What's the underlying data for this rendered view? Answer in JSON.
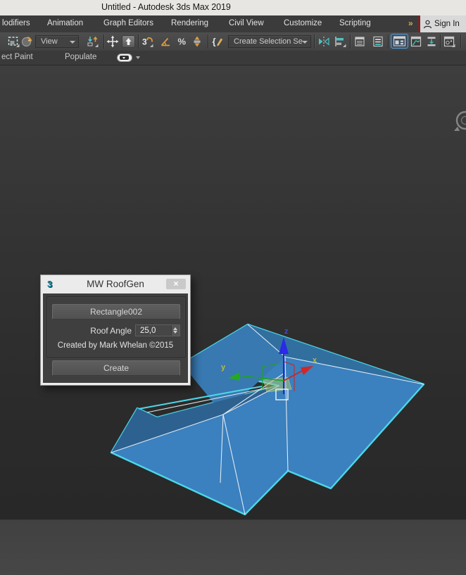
{
  "window": {
    "title": "Untitled - Autodesk 3ds Max 2019"
  },
  "menubar": {
    "items": [
      "lodifiers",
      "Animation",
      "Graph Editors",
      "Rendering",
      "Civil View",
      "Customize",
      "Scripting"
    ],
    "overflow_chevron": "»",
    "sign_in_label": "Sign In"
  },
  "toolbar": {
    "reference_coordinate_value": "View",
    "named_selection_set_placeholder": "Create Selection Se",
    "snap_3d_label": "3",
    "percent_snap_label": "%",
    "named_sets_label": "{"
  },
  "ribbon": {
    "tab_object_paint": "ect Paint",
    "tab_populate": "Populate"
  },
  "dialog": {
    "logo_glyph": "3",
    "title": "MW RoofGen",
    "close_label": "×",
    "shape_button_label": "Rectangle002",
    "roof_angle_label": "Roof Angle",
    "roof_angle_value": "25,0",
    "credit": "Created by Mark Whelan ©2015",
    "create_button_label": "Create"
  },
  "viewport": {
    "axis_labels": {
      "x": "x",
      "y": "y",
      "z": "z"
    },
    "selected_object": "Rectangle002 roof mesh",
    "colors": {
      "roof_fill": "#3b80bf",
      "roof_fill_top": "#316f9f",
      "roof_fill_wing": "#2d6190",
      "selection_outline": "#4bd7e9",
      "edge_lines": "#e8f0f4",
      "axis_x": "#cf2222",
      "axis_y": "#1fa321",
      "axis_z": "#2a2ae8",
      "axis_label_xy": "#b9ba40",
      "viewport_top": "#3e3e3e",
      "viewport_bottom": "#282828"
    }
  }
}
